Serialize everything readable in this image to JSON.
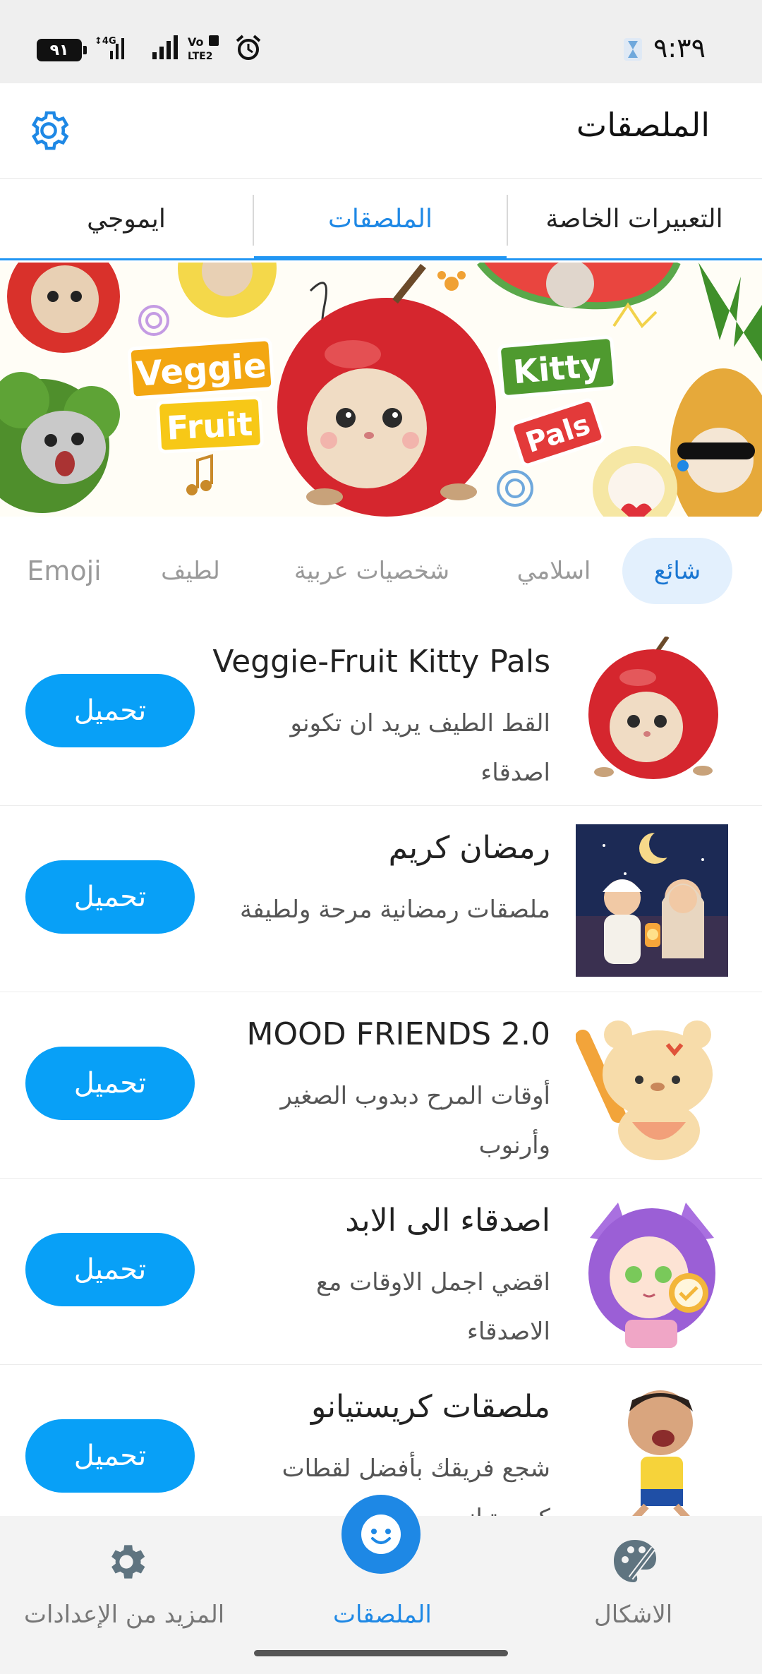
{
  "status_bar": {
    "battery": "٩١",
    "network_4g": "4G",
    "volte": "Vo LTE",
    "time": "٩:٣٩"
  },
  "app_bar": {
    "title": "الملصقات",
    "settings_icon": "gear-icon"
  },
  "tabs": [
    {
      "label": "التعبيرات الخاصة",
      "active": false
    },
    {
      "label": "الملصقات",
      "active": true
    },
    {
      "label": "ايموجي",
      "active": false
    }
  ],
  "banner": {
    "text_line1": "Veggie",
    "text_line2": "Fruit",
    "text_line3": "Kitty",
    "text_line4": "Pals"
  },
  "categories": [
    {
      "label": "شائع",
      "active": true
    },
    {
      "label": "اسلامي",
      "active": false
    },
    {
      "label": "شخصيات عربية",
      "active": false
    },
    {
      "label": "لطيف",
      "active": false
    },
    {
      "label": "Emoji",
      "active": false
    }
  ],
  "packs": [
    {
      "title": "Veggie-Fruit Kitty Pals",
      "desc_line1": "القط الطيف يريد ان تكونو",
      "desc_line2": "اصدقاء",
      "button": "تحميل"
    },
    {
      "title": "رمضان كريم",
      "desc_line1": "ملصقات رمضانية مرحة ولطيفة",
      "desc_line2": "",
      "button": "تحميل"
    },
    {
      "title": "MOOD FRIENDS 2.0",
      "desc_line1": "أوقات المرح دبدوب الصغير",
      "desc_line2": "وأرنوب",
      "button": "تحميل"
    },
    {
      "title": "اصدقاء الى الابد",
      "desc_line1": "اقضي اجمل الاوقات مع",
      "desc_line2": "الاصدقاء",
      "button": "تحميل"
    },
    {
      "title": "ملصقات كريستيانو",
      "desc_line1": "شجع فريقك بأفضل لقطات",
      "desc_line2": "كريستيانو",
      "button": "تحميل"
    }
  ],
  "bottom_nav": [
    {
      "label": "المزيد من الإعدادات",
      "icon": "gear-icon"
    },
    {
      "label": "الملصقات",
      "icon": "smiley-icon",
      "active": true
    },
    {
      "label": "الاشكال",
      "icon": "palette-icon"
    }
  ],
  "colors": {
    "accent": "#2196f3",
    "button": "#08a0f7",
    "chip_bg": "#e3f0fd"
  }
}
